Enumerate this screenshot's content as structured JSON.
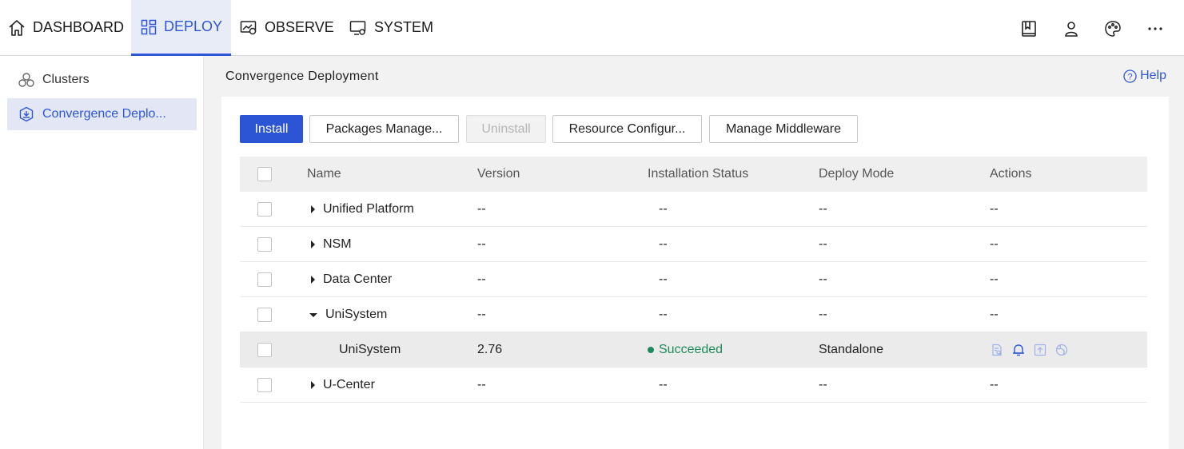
{
  "nav": {
    "tabs": [
      {
        "label": "DASHBOARD",
        "icon": "home-icon"
      },
      {
        "label": "DEPLOY",
        "icon": "grid-icon",
        "active": true
      },
      {
        "label": "OBSERVE",
        "icon": "monitor-chart-icon"
      },
      {
        "label": "SYSTEM",
        "icon": "monitor-gear-icon"
      }
    ],
    "right_icons": [
      "book-icon",
      "user-icon",
      "palette-icon",
      "more-icon"
    ]
  },
  "sidebar": {
    "items": [
      {
        "label": "Clusters",
        "icon": "clusters-icon"
      },
      {
        "label": "Convergence Deplo...",
        "icon": "deploy-hex-icon",
        "active": true
      }
    ]
  },
  "page": {
    "title": "Convergence Deployment",
    "help": "Help"
  },
  "toolbar": {
    "install": "Install",
    "packages": "Packages Manage...",
    "uninstall": "Uninstall",
    "resource": "Resource Configur...",
    "middleware": "Manage Middleware"
  },
  "table": {
    "headers": {
      "name": "Name",
      "version": "Version",
      "status": "Installation Status",
      "mode": "Deploy Mode",
      "actions": "Actions"
    },
    "rows": [
      {
        "name": "Unified Platform",
        "version": "--",
        "status": "--",
        "mode": "--",
        "actions": "--",
        "expand": "collapsed"
      },
      {
        "name": "NSM",
        "version": "--",
        "status": "--",
        "mode": "--",
        "actions": "--",
        "expand": "collapsed"
      },
      {
        "name": "Data Center",
        "version": "--",
        "status": "--",
        "mode": "--",
        "actions": "--",
        "expand": "collapsed"
      },
      {
        "name": "UniSystem",
        "version": "--",
        "status": "--",
        "mode": "--",
        "actions": "--",
        "expand": "expanded"
      },
      {
        "name": "UniSystem",
        "version": "2.76",
        "status": "Succeeded",
        "mode": "Standalone",
        "child": true,
        "action_icons": [
          "view-log-icon",
          "alert-bell-icon",
          "upgrade-icon",
          "network-icon"
        ]
      },
      {
        "name": "U-Center",
        "version": "--",
        "status": "--",
        "mode": "--",
        "actions": "--",
        "expand": "collapsed"
      }
    ]
  },
  "colors": {
    "accent": "#2b55d4",
    "success": "#1f8a5b"
  }
}
